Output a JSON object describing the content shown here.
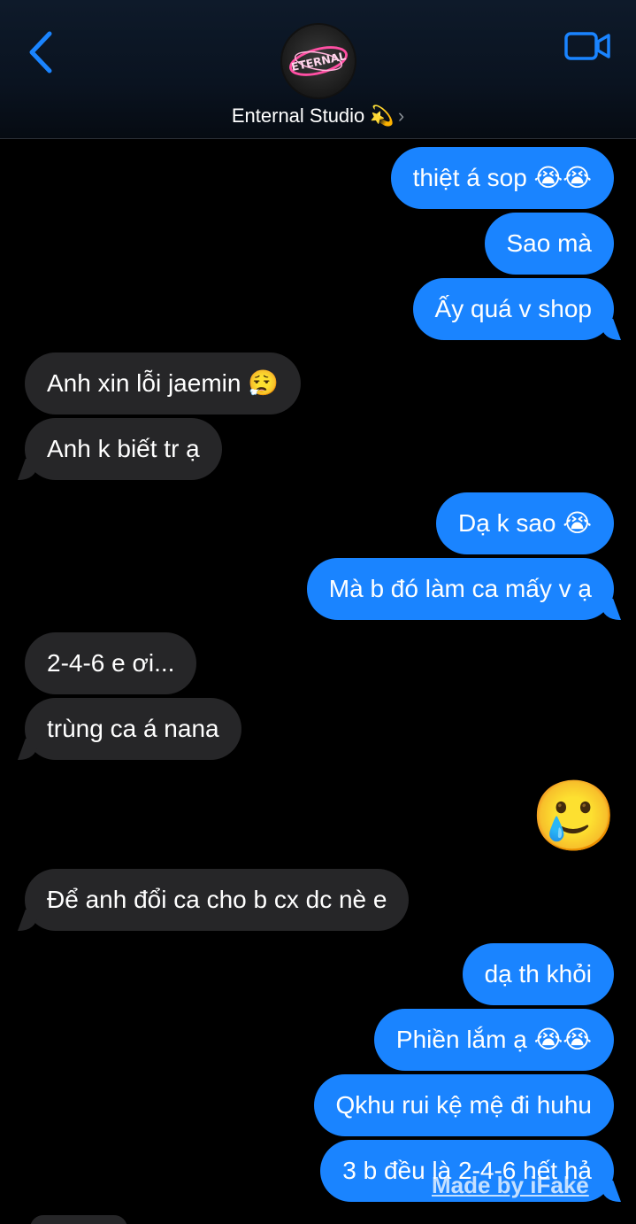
{
  "header": {
    "contact_name": "Enternal Studio 💫",
    "chevron": "›",
    "back_icon": "chevron-left-icon",
    "video_icon": "video-camera-icon",
    "avatar_text": "ETERNAL",
    "accent": "#1a84ff"
  },
  "messages": [
    {
      "dir": "out",
      "text": "thiệt á sop 😭😭"
    },
    {
      "dir": "out",
      "text": "Sao mà"
    },
    {
      "dir": "out",
      "text": "Ấy quá v shop"
    },
    {
      "dir": "in",
      "text": "Anh xin lỗi jaemin 😮‍💨"
    },
    {
      "dir": "in",
      "text": "Anh k biết tr ạ"
    },
    {
      "dir": "out",
      "text": "Dạ k sao 😭"
    },
    {
      "dir": "out",
      "text": "Mà b đó làm ca mấy v ạ"
    },
    {
      "dir": "in",
      "text": "2-4-6 e ơi..."
    },
    {
      "dir": "in",
      "text": "trùng ca á nana"
    },
    {
      "dir": "out",
      "text": "🥲",
      "big": true
    },
    {
      "dir": "in",
      "text": "Để anh đổi ca cho b cx dc nè e"
    },
    {
      "dir": "out",
      "text": "dạ th khỏi"
    },
    {
      "dir": "out",
      "text": "Phiền lắm ạ 😭😭"
    },
    {
      "dir": "out",
      "text": "Qkhu rui kệ mệ đi huhu"
    },
    {
      "dir": "out",
      "text": "3 b đều là 2-4-6 hết hả"
    }
  ],
  "watermark": "Made by iFake",
  "colors": {
    "outgoing": "#1a84ff",
    "incoming": "#262628",
    "background": "#000000"
  }
}
